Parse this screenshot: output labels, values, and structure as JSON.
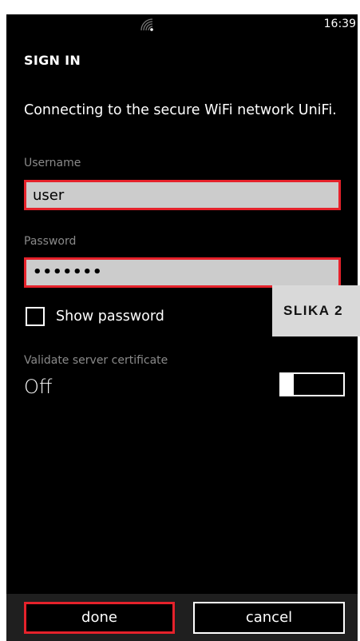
{
  "status_bar": {
    "time": "16:39",
    "signal_icon": "wifi-signal-icon"
  },
  "page_title": "SIGN IN",
  "description": "Connecting to the secure WiFi network UniFi.",
  "username": {
    "label": "Username",
    "value": "user"
  },
  "password": {
    "label": "Password",
    "value": "•••••••"
  },
  "show_password": {
    "label": "Show password",
    "checked": false
  },
  "overlay_label": "SLIKA 2",
  "validate_certificate": {
    "label": "Validate server certificate",
    "value": "Off"
  },
  "app_bar": {
    "done_label": "done",
    "cancel_label": "cancel"
  },
  "colors": {
    "highlight": "#e5222b",
    "field_bg": "#cccccc",
    "label_gray": "#8a8a8a"
  }
}
